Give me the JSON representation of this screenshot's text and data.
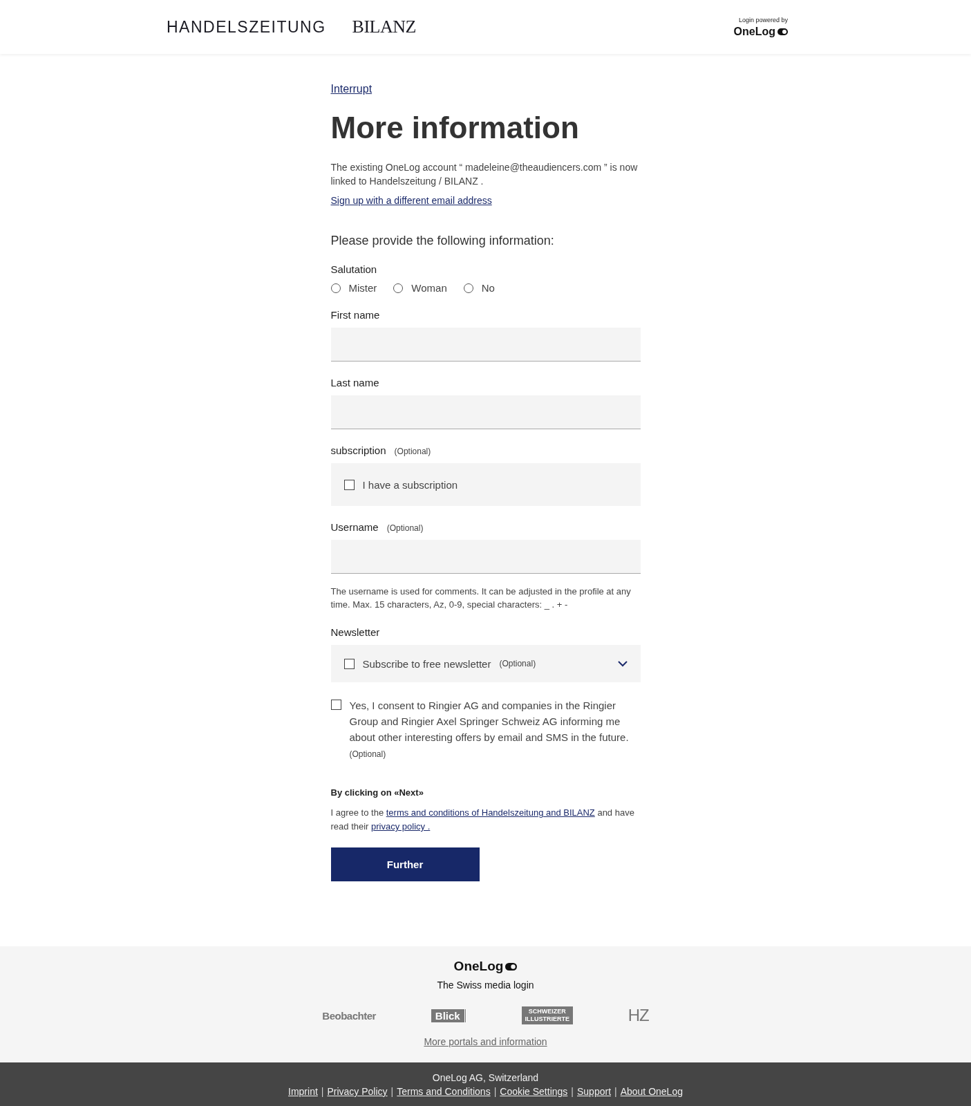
{
  "header": {
    "brands": [
      "HANDELSZEITUNG",
      "BILANZ"
    ],
    "powered_by": "Login powered by",
    "login_brand": "OneLog"
  },
  "back_link": "Interrupt",
  "title": "More information",
  "intro": "The existing OneLog account “ madeleine@theaudiencers.com ” is now linked to Handelszeitung / BILANZ .",
  "alt_link": "Sign up with a different email address",
  "prompt": "Please provide the following information:",
  "fields": [
    {
      "kind": "radio",
      "label": "Salutation",
      "options": [
        {
          "label": "Mister",
          "selected": false
        },
        {
          "label": "Woman",
          "selected": false
        },
        {
          "label": "No",
          "selected": false
        }
      ]
    },
    {
      "kind": "text",
      "label": "First name"
    },
    {
      "kind": "text",
      "label": "Last name"
    },
    {
      "kind": "checkbox",
      "label": "subscription",
      "optional": "(Optional)",
      "option": {
        "label": "I have a subscription",
        "checked": false
      }
    },
    {
      "kind": "text",
      "label": "Username",
      "optional": "(Optional)",
      "help": "The username is used for comments. It can be adjusted in the profile at any time. Max. 15 characters, Az, 0-9, special characters: _ . + -"
    },
    {
      "kind": "dropdown",
      "label": "Newsletter",
      "expanded": false,
      "option": {
        "label": "Subscribe to free newsletter",
        "optional": "(Optional)",
        "checked": false
      }
    },
    {
      "kind": "consent",
      "text": "Yes, I consent to Ringier AG and companies in the Ringier Group and Ringier Axel Springer Schweiz AG informing me about other interesting offers by email and SMS in the future.",
      "optional": "(Optional)",
      "checked": false
    }
  ],
  "terms": {
    "heading": "By clicking on «Next»",
    "parts": [
      {
        "kind": "text",
        "text": "I agree to the "
      },
      {
        "kind": "link",
        "text": "terms and conditions of Handelszeitung and BILANZ"
      },
      {
        "kind": "text",
        "text": " and have read their "
      },
      {
        "kind": "link",
        "text": "privacy policy ."
      }
    ]
  },
  "submit": "Further",
  "footer": {
    "brand": "OneLog",
    "tagline": "The Swiss media login",
    "portals": [
      {
        "kind": "wordmark",
        "text": "Beobachter"
      },
      {
        "kind": "boxed",
        "text": "Blick"
      },
      {
        "kind": "stacked",
        "text": "SCHWEIZER ILLUSTRIERTE"
      },
      {
        "kind": "thin",
        "text": "HZ"
      }
    ],
    "more_link": "More portals and information",
    "company": "OneLog AG, Switzerland",
    "separator": "|",
    "links": [
      "Imprint",
      "Privacy Policy",
      "Terms and Conditions",
      "Cookie Settings",
      "Support",
      "About OneLog"
    ]
  }
}
